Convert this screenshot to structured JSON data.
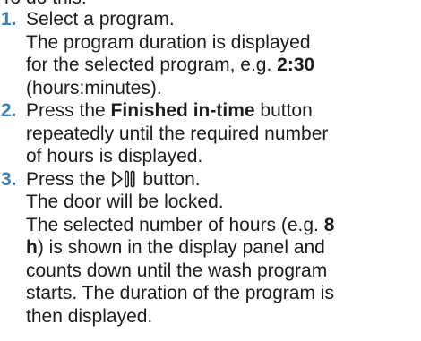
{
  "intro": "To do this:",
  "accent_color": "#3a80b9",
  "steps": [
    {
      "number": "1.",
      "lines": [
        [
          "Select a program."
        ],
        [
          "The program duration is displayed"
        ],
        [
          "for the selected program, e.g. ",
          {
            "b": "2:30"
          }
        ],
        [
          "(hours:minutes)."
        ]
      ]
    },
    {
      "number": "2.",
      "lines": [
        [
          "Press the ",
          {
            "b": "Finished in-time"
          },
          " button"
        ],
        [
          "repeatedly until the required number"
        ],
        [
          "of hours is displayed."
        ]
      ]
    },
    {
      "number": "3.",
      "lines": [
        [
          "Press the ",
          {
            "icon": "start-pause-icon"
          },
          " button."
        ],
        [
          "The door will be locked."
        ],
        [
          "The selected number of hours (e.g. ",
          {
            "b": "8"
          }
        ],
        [
          {
            "b": "h"
          },
          ") is shown in the display panel and"
        ],
        [
          "counts down until the wash program"
        ],
        [
          "starts. The duration of the program is"
        ],
        [
          "then displayed."
        ]
      ]
    }
  ]
}
